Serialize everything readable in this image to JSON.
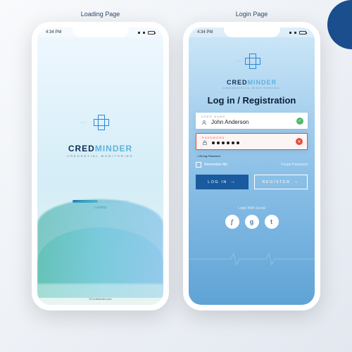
{
  "labels": {
    "loading_page": "Loading Page",
    "login_page": "Login Page"
  },
  "status": {
    "time": "4:34 PM"
  },
  "brand": {
    "part1": "CRED",
    "part2": "MINDER",
    "tagline": "CREDENTIAL MONITORING"
  },
  "loading": {
    "text": "Loading",
    "footer": "©Credminder.com"
  },
  "login": {
    "heading": "Log in / Registration",
    "username_label": "USER NAME",
    "username_value": "John Anderson",
    "password_label": "PASSWORD",
    "error_msg": "• Wrong Password",
    "remember": "Remember Me",
    "forgot": "Forgot Password",
    "login_btn": "LOG IN",
    "register_btn": "REGISTER",
    "social_label": "Login With Social",
    "social": {
      "fb": "f",
      "g": "g",
      "tw": "t"
    }
  },
  "colors": {
    "accent": "#2a88d9",
    "error": "#e74c3c",
    "success": "#4fb868",
    "primary_btn": "#1a5a9e"
  }
}
